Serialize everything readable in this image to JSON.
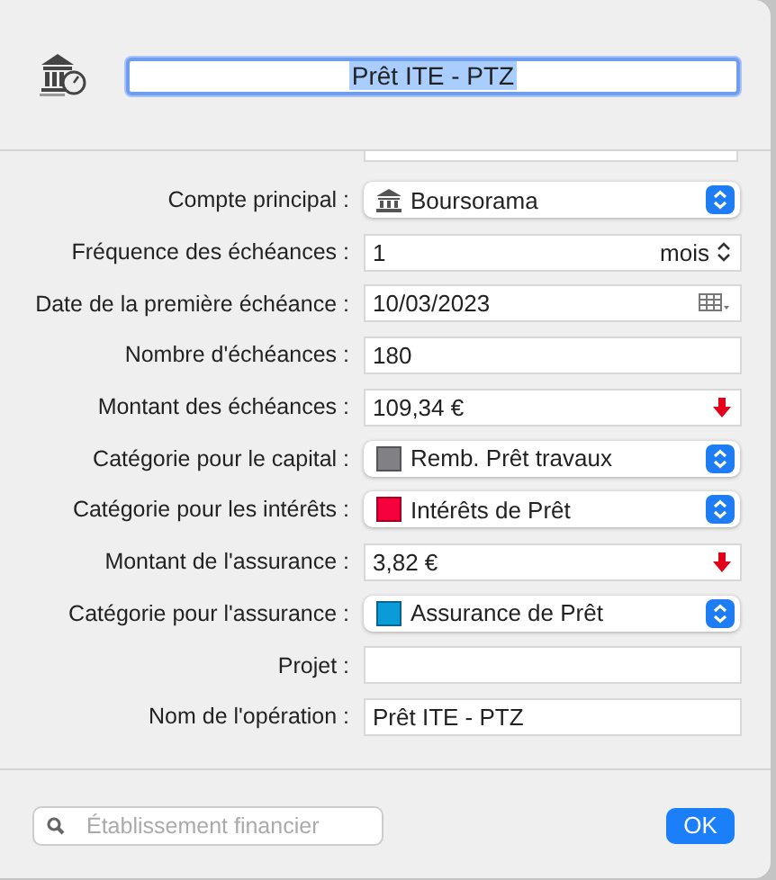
{
  "title_field": {
    "value": "Prêt ITE - PTZ",
    "selected": true
  },
  "rows": [
    {
      "label": "Compte principal :",
      "kind": "account",
      "value": "Boursorama"
    },
    {
      "label": "Fréquence des échéances :",
      "kind": "stepper",
      "value": "1",
      "unit": "mois"
    },
    {
      "label": "Date de la première échéance :",
      "kind": "date",
      "value": "10/03/2023"
    },
    {
      "label": "Nombre d'échéances :",
      "kind": "text",
      "value": "180"
    },
    {
      "label": "Montant des échéances :",
      "kind": "amount",
      "value": "109,34 €"
    },
    {
      "label": "Catégorie pour le capital :",
      "kind": "popup",
      "value": "Remb. Prêt travaux",
      "color": "#818185"
    },
    {
      "label": "Catégorie pour les intérêts :",
      "kind": "popup",
      "value": "Intérêts de Prêt",
      "color": "#f5003a"
    },
    {
      "label": "Montant de l'assurance :",
      "kind": "amount",
      "value": "3,82 €"
    },
    {
      "label": "Catégorie pour l'assurance :",
      "kind": "popup",
      "value": "Assurance de Prêt",
      "color": "#0a9bd8"
    },
    {
      "label": "Projet :",
      "kind": "text"
    },
    {
      "label": "Nom de l'opération :",
      "kind": "text",
      "value": "Prêt ITE - PTZ"
    }
  ],
  "search": {
    "placeholder": "Établissement financier"
  },
  "buttons": [
    "OK"
  ]
}
